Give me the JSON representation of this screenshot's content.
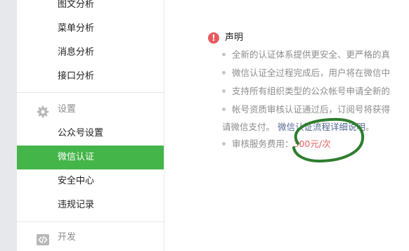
{
  "sidebar": {
    "items_top": [
      {
        "label": "图文分析"
      },
      {
        "label": "菜单分析"
      },
      {
        "label": "消息分析"
      },
      {
        "label": "接口分析"
      }
    ],
    "settings_section": {
      "title": "设置",
      "icon": "gear-icon",
      "items": [
        {
          "label": "公众号设置"
        },
        {
          "label": "微信认证",
          "active": true
        },
        {
          "label": "安全中心"
        },
        {
          "label": "违规记录"
        }
      ]
    },
    "dev_section": {
      "title": "开发",
      "icon": "code-icon"
    }
  },
  "notice": {
    "title": "声明",
    "lines": [
      "全新的认证体系提供更安全、更严格的真",
      "微信认证全过程完成后，用户将在微信中",
      "支持所有组织类型的公众帐号申请全新的",
      "帐号资质审核认证通过后，订阅号将获得"
    ],
    "continuation_text": "请微信支付。",
    "link_text": "微信认证流程详细说明",
    "link_suffix": "。",
    "fee_label": "审核服务费用：",
    "fee_value": "300元/次"
  },
  "colors": {
    "active_green": "#44b549",
    "alert_red": "#e85a5f",
    "link_blue": "#576b95",
    "fee_red": "#e15f63",
    "annotation_circle": "#2e7d2e"
  }
}
